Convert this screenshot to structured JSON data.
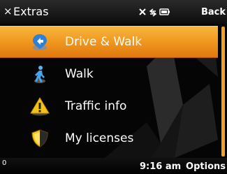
{
  "status_bar": {
    "close_glyph": "×",
    "title": "Extras",
    "back_label": "Back",
    "icons": [
      "bluetooth-icon",
      "data-connection-icon",
      "battery-icon"
    ]
  },
  "menu": {
    "items": [
      {
        "label": "Drive & Walk",
        "icon": "drive-walk-icon",
        "selected": true
      },
      {
        "label": "Walk",
        "icon": "walk-icon",
        "selected": false
      },
      {
        "label": "Traffic info",
        "icon": "traffic-warning-icon",
        "selected": false
      },
      {
        "label": "My licenses",
        "icon": "license-shield-icon",
        "selected": false
      }
    ]
  },
  "bottom_bar": {
    "signal_text": "0",
    "time": "9:16 am",
    "options_label": "Options"
  },
  "colors": {
    "highlight": "#f19a21",
    "background": "#050505",
    "text": "#ffffff"
  }
}
